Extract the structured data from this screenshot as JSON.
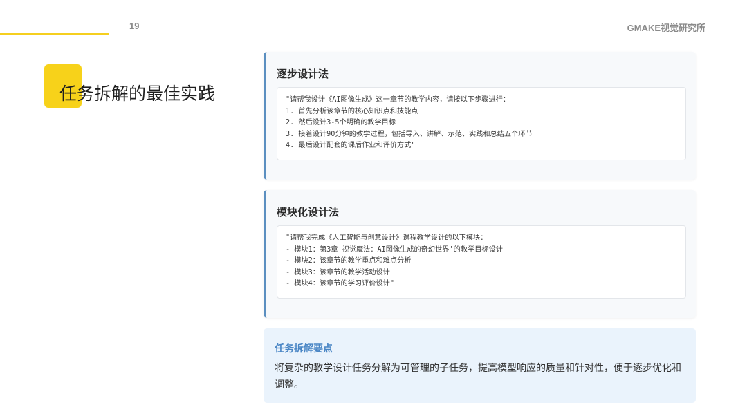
{
  "header": {
    "page_number": "19",
    "brand": "GMAKE视觉研究所"
  },
  "page_title": "任务拆解的最佳实践",
  "cards": [
    {
      "title": "逐步设计法",
      "lines": [
        "\"请帮我设计《AI图像生成》这一章节的教学内容，请按以下步骤进行：",
        "1. 首先分析该章节的核心知识点和技能点",
        "2. 然后设计3-5个明确的教学目标",
        "3. 接着设计90分钟的教学过程，包括导入、讲解、示范、实践和总结五个环节",
        "4. 最后设计配套的课后作业和评价方式\""
      ]
    },
    {
      "title": "模块化设计法",
      "lines": [
        "\"请帮我完成《人工智能与创意设计》课程教学设计的以下模块：",
        "- 模块1：第3章'视觉魔法：AI图像生成的奇幻世界'的教学目标设计",
        "- 模块2：该章节的教学重点和难点分析",
        "- 模块3：该章节的教学活动设计",
        "- 模块4：该章节的学习评价设计\""
      ]
    }
  ],
  "tip": {
    "title": "任务拆解要点",
    "text": "将复杂的教学设计任务分解为可管理的子任务，提高模型响应的质量和针对性，便于逐步优化和调整。"
  },
  "colors": {
    "accent_yellow": "#f7d21a",
    "card_border_blue": "#5b8fc0",
    "tip_background": "#eaf3fc",
    "tip_title_blue": "#4a86c5"
  }
}
